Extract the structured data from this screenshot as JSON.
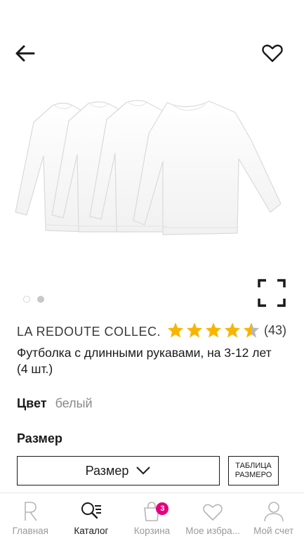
{
  "header": {
    "back_icon": "arrow-left-icon",
    "favorite_icon": "heart-outline-icon"
  },
  "gallery": {
    "image_alt": "four white long-sleeve t-shirts",
    "page_count": 2,
    "active_page": 2,
    "fullscreen_icon": "expand-corners-icon"
  },
  "product": {
    "brand": "LA REDOUTE COLLEC...",
    "rating": 4.5,
    "rating_max": 5,
    "rating_count": "(43)",
    "title": "Футболка с длинными рукавами, на 3-12 лет (4 шт.)"
  },
  "color": {
    "label": "Цвет",
    "value": "белый"
  },
  "size": {
    "label": "Размер",
    "select_label": "Размер",
    "table_button_line1": "ТАБЛИЦА",
    "table_button_line2": "РАЗМЕРО"
  },
  "nav": {
    "items": [
      {
        "label": "Главная",
        "icon": "home-r-icon"
      },
      {
        "label": "Каталог",
        "icon": "catalog-search-icon"
      },
      {
        "label": "Корзина",
        "icon": "shopping-bag-icon",
        "badge": "3"
      },
      {
        "label": "Мое избра...",
        "icon": "heart-icon"
      },
      {
        "label": "Мой счет",
        "icon": "user-icon"
      }
    ],
    "active_index": 1
  },
  "colors": {
    "accent_badge": "#e6007e",
    "star": "#f7b500",
    "text_primary": "#1a1a1a",
    "text_muted": "#9a9a9a"
  }
}
